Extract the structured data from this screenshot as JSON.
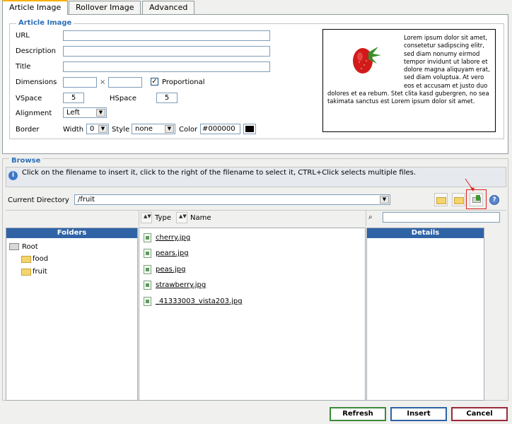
{
  "tabs": [
    {
      "label": "Article Image"
    },
    {
      "label": "Rollover Image"
    },
    {
      "label": "Advanced"
    }
  ],
  "article_image": {
    "legend": "Article Image",
    "url_label": "URL",
    "url_value": "",
    "description_label": "Description",
    "description_value": "",
    "title_label": "Title",
    "title_value": "",
    "dimensions_label": "Dimensions",
    "width_value": "",
    "times": "×",
    "height_value": "",
    "proportional_label": "Proportional",
    "proportional_checked": true,
    "vspace_label": "VSpace",
    "vspace_value": "5",
    "hspace_label": "HSpace",
    "hspace_value": "5",
    "alignment_label": "Alignment",
    "alignment_value": "Left",
    "border_label": "Border",
    "width_label": "Width",
    "border_width_value": "0",
    "style_label": "Style",
    "style_value": "none",
    "color_label": "Color",
    "color_value": "#000000",
    "color_swatch": "#000000"
  },
  "preview": {
    "text": "Lorem ipsum dolor sit amet, consetetur sadipscing elitr, sed diam nonumy eirmod tempor invidunt ut labore et dolore magna aliquyam erat, sed diam voluptua. At vero eos et accusam et justo duo dolores et ea rebum. Stet clita kasd gubergren, no sea takimata sanctus est Lorem ipsum dolor sit amet."
  },
  "browse": {
    "legend": "Browse",
    "info_text": "Click on the filename to insert it, click to the right of the filename to select it, CTRL+Click selects multiple files.",
    "current_directory_label": "Current Directory",
    "current_directory_value": "/fruit",
    "sort_type_label": "Type",
    "sort_name_label": "Name",
    "search_value": "",
    "folders_header": "Folders",
    "details_header": "Details",
    "folders": [
      {
        "name": "Root"
      },
      {
        "name": "food"
      },
      {
        "name": "fruit"
      }
    ],
    "files": [
      {
        "name": "cherry.jpg"
      },
      {
        "name": "pears.jpg"
      },
      {
        "name": "peas.jpg"
      },
      {
        "name": "strawberry.jpg"
      },
      {
        "name": "_41333003_vista203.jpg"
      }
    ]
  },
  "buttons": {
    "refresh": "Refresh",
    "insert": "Insert",
    "cancel": "Cancel"
  },
  "colors": {
    "accent_blue": "#2f63a6",
    "legend_blue": "#2b6fb6",
    "highlight_red": "#e02020"
  }
}
